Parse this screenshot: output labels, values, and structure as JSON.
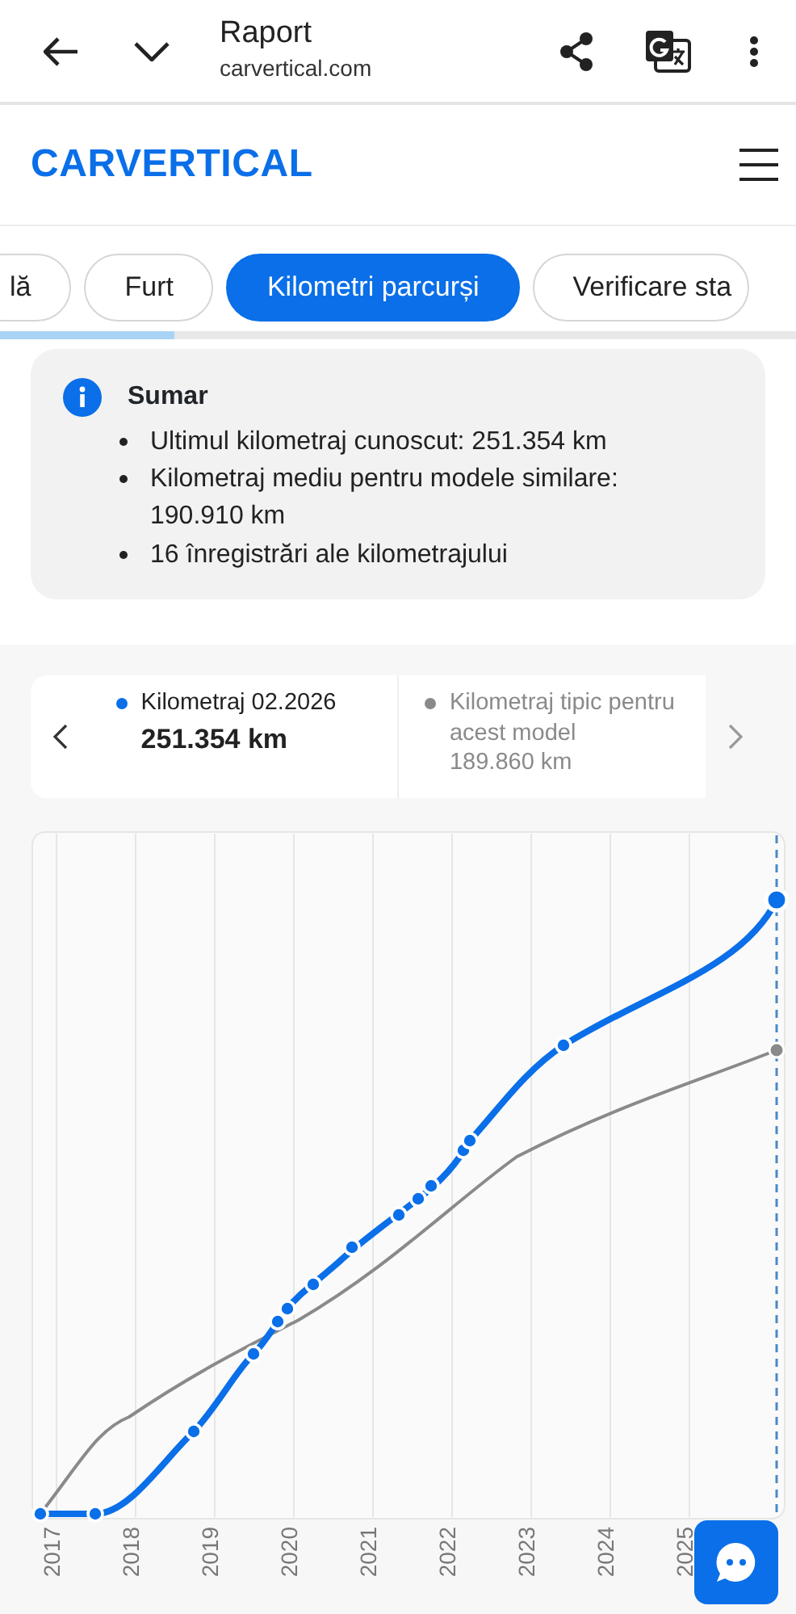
{
  "browser_bar": {
    "title": "Raport",
    "url": "carvertical.com"
  },
  "header": {
    "logo": "CARVERTICAL"
  },
  "tabs": [
    {
      "label": "lă",
      "selected": false
    },
    {
      "label": "Furt",
      "selected": false
    },
    {
      "label": "Kilometri parcurși",
      "selected": true
    },
    {
      "label": "Verificare sta",
      "selected": false
    }
  ],
  "tab_progress": {
    "level": 0.22
  },
  "summary": {
    "title": "Sumar",
    "items": [
      "Ultimul kilometraj cunoscut: 251.354 km",
      "Kilometraj mediu pentru modele similare: 190.910 km",
      "16 înregistrări ale kilometrajului"
    ]
  },
  "legend": [
    {
      "label": "Kilometraj 02.2026",
      "value": "251.354 km",
      "color": "#0a6fe8",
      "selected": true
    },
    {
      "label": "Kilometraj tipic pentru acest model",
      "value": "189.860 km",
      "color": "#8a8a8a",
      "selected": false
    }
  ],
  "chart": {
    "years": [
      "2017",
      "2018",
      "2019",
      "2020",
      "2021",
      "2022",
      "2023",
      "2024",
      "2025"
    ]
  }
}
